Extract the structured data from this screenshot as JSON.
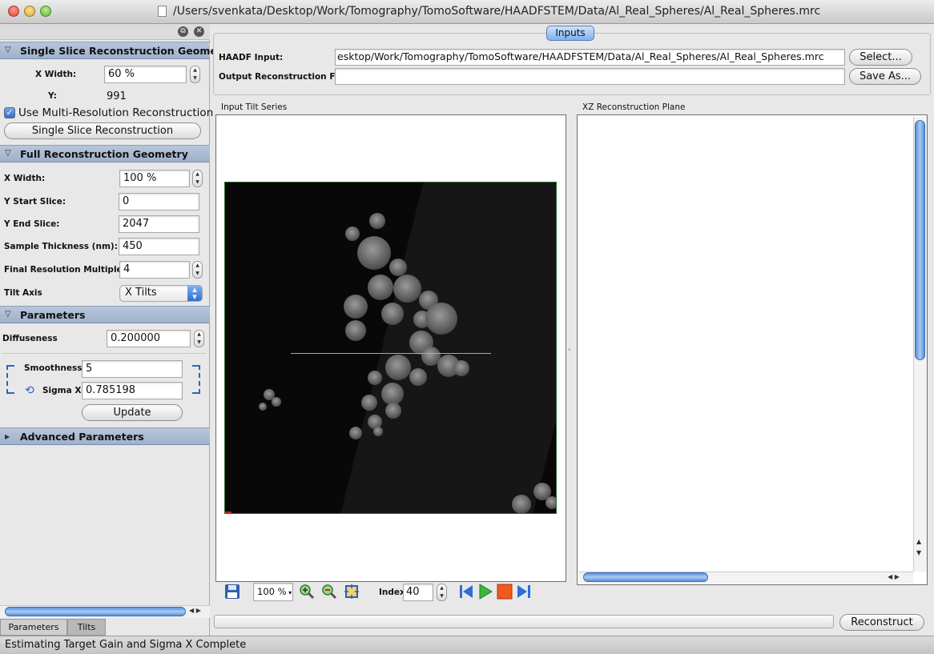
{
  "window": {
    "title": "/Users/svenkata/Desktop/Work/Tomography/TomoSoftware/HAADFSTEM/Data/Al_Real_Spheres/Al_Real_Spheres.mrc"
  },
  "sidebar": {
    "single_slice": {
      "header": "Single Slice Reconstruction Geometry",
      "x_width_label": "X Width:",
      "x_width_value": "60 %",
      "y_label": "Y:",
      "y_value": "991",
      "multires_label": "Use Multi-Resolution Reconstruction",
      "multires_checked": true,
      "button": "Single Slice Reconstruction"
    },
    "full": {
      "header": "Full Reconstruction Geometry",
      "x_width_label": "X Width:",
      "x_width_value": "100 %",
      "y_start_label": "Y Start Slice:",
      "y_start_value": "0",
      "y_end_label": "Y End Slice:",
      "y_end_value": "2047",
      "thickness_label": "Sample Thickness (nm):",
      "thickness_value": "450",
      "final_res_label": "Final Resolution Multiple:",
      "final_res_value": "4",
      "tilt_axis_label": "Tilt Axis",
      "tilt_axis_value": "X Tilts"
    },
    "parameters": {
      "header": "Parameters",
      "diffuseness_label": "Diffuseness",
      "diffuseness_value": "0.200000",
      "smoothness_label": "Smoothness:",
      "smoothness_value": "5",
      "sigma_label": "Sigma X:",
      "sigma_value": "0.785198",
      "update_button": "Update"
    },
    "advanced": {
      "header": "Advanced Parameters"
    },
    "tabs": [
      "Parameters",
      "Tilts"
    ]
  },
  "inputs": {
    "tab_label": "Inputs",
    "haadf_label": "HAADF Input:",
    "haadf_value": "esktop/Work/Tomography/TomoSoftware/HAADFSTEM/Data/Al_Real_Spheres/Al_Real_Spheres.mrc",
    "output_label": "Output Reconstruction File:",
    "output_value": "",
    "select_button": "Select...",
    "save_button": "Save As..."
  },
  "views": {
    "tilt_title": "Input Tilt Series",
    "xz_title": "XZ Reconstruction Plane"
  },
  "toolbar": {
    "zoom": "100 %",
    "index_label": "Index",
    "index_value": "40"
  },
  "reconstruct_button": "Reconstruct",
  "status": "Estimating Target Gain and Sigma X Complete",
  "colors": {
    "section_header": "#a8b9d2",
    "accent_blue": "#2f6fd3",
    "window_bg": "#e8e8e8"
  },
  "icons": {
    "save": "floppy-disk-icon",
    "zoom_in": "zoom-in-icon",
    "zoom_out": "zoom-out-icon",
    "fit": "fit-to-window-icon",
    "first": "skip-to-first-icon",
    "play": "play-icon",
    "stop": "stop-icon",
    "last": "skip-to-last-icon"
  }
}
